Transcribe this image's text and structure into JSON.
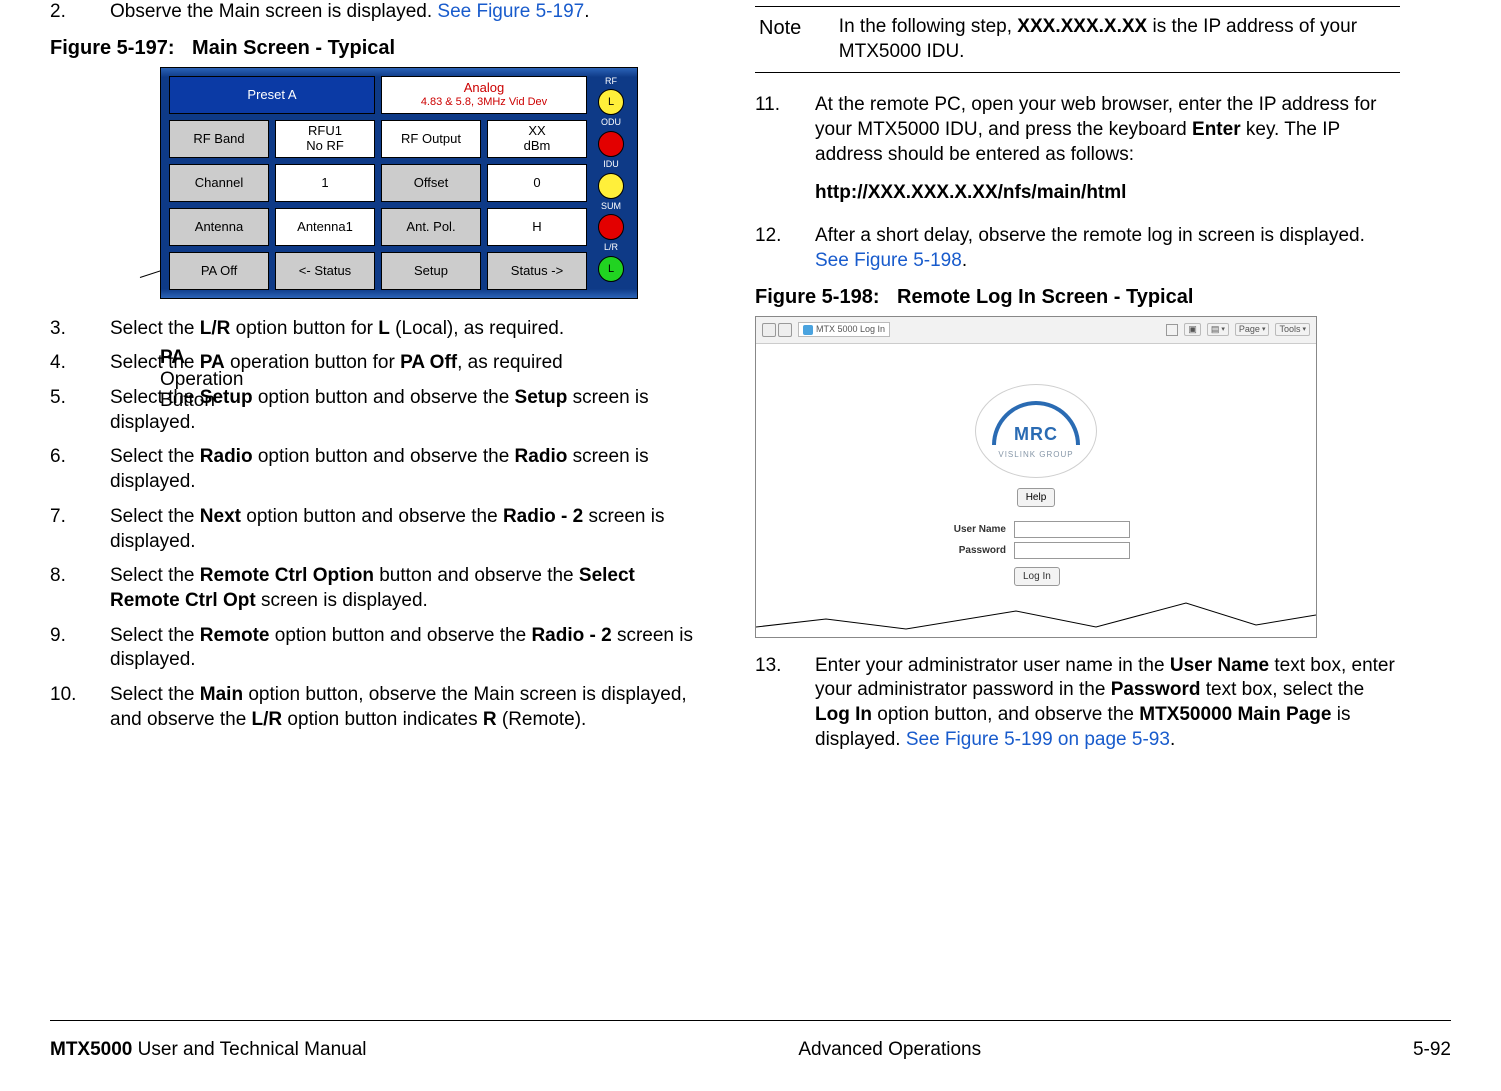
{
  "left": {
    "step2_num": "2.",
    "step2_a": "Observe the Main screen is displayed.  ",
    "step2_link": "See Figure 5-197",
    "step2_dot": ".",
    "fig197_label": "Figure 5-197:",
    "fig197_title": "Main Screen - Typical",
    "callout_l1": "PA",
    "callout_l2": "Operation",
    "callout_l3": "Button",
    "device": {
      "preset": "Preset A",
      "analog1": "Analog",
      "analog2": "4.83 & 5.8, 3MHz Vid Dev",
      "rfband": "RF Band",
      "rfu": "RFU1\nNo RF",
      "rfout": "RF Output",
      "dbm": "XX\ndBm",
      "channel": "Channel",
      "ch_val": "1",
      "offset": "Offset",
      "off_val": "0",
      "antenna": "Antenna",
      "ant_val": "Antenna1",
      "antpol": "Ant. Pol.",
      "pol_val": "H",
      "paoff": "PA Off",
      "back": "<- Status",
      "setup": "Setup",
      "fwd": "Status ->",
      "s_rf": "RF",
      "s_odu": "ODU",
      "s_idu": "IDU",
      "s_sum": "SUM",
      "s_lr": "L/R",
      "led_l": "L"
    },
    "s3n": "3.",
    "s3a": "Select the ",
    "s3b": "L/R",
    "s3c": " option button for ",
    "s3d": "L",
    "s3e": " (Local), as required.",
    "s4n": "4.",
    "s4a": "Select the ",
    "s4b": "PA",
    "s4c": " operation button for ",
    "s4d": "PA Off",
    "s4e": ", as required",
    "s5n": "5.",
    "s5a": "Select the ",
    "s5b": "Setup",
    "s5c": " option button and observe the ",
    "s5d": "Setup",
    "s5e": " screen is displayed.",
    "s6n": "6.",
    "s6a": "Select the ",
    "s6b": "Radio",
    "s6c": " option button and observe the ",
    "s6d": "Radio",
    "s6e": " screen is displayed.",
    "s7n": "7.",
    "s7a": "Select the ",
    "s7b": "Next",
    "s7c": " option button and observe the ",
    "s7d": "Radio - 2",
    "s7e": " screen is displayed.",
    "s8n": "8.",
    "s8a": "Select the ",
    "s8b": "Remote Ctrl Option",
    "s8c": " button and observe the ",
    "s8d": "Select Remote Ctrl Opt",
    "s8e": " screen is displayed.",
    "s9n": "9.",
    "s9a": "Select the ",
    "s9b": "Remote",
    "s9c": " option button and observe the ",
    "s9d": "Radio - 2",
    "s9e": " screen is displayed.",
    "s10n": "10.",
    "s10a": "Select the ",
    "s10b": "Main",
    "s10c": " option button, observe the Main screen is displayed, and observe the ",
    "s10d": "L/R",
    "s10e": " option button indicates ",
    "s10f": "R",
    "s10g": " (Remote)."
  },
  "right": {
    "note_label": "Note",
    "note_a": "In the following step, ",
    "note_b": "XXX.XXX.X.XX",
    "note_c": " is the IP address of your MTX5000 IDU.",
    "s11n": "11.",
    "s11a": "At the remote PC, open your web browser, enter the IP address for your MTX5000 IDU, and press the keyboard ",
    "s11b": "Enter",
    "s11c": " key.  The IP address should be entered as follows:",
    "url": "http://XXX.XXX.X.XX/nfs/main/html",
    "s12n": "12.",
    "s12a": "After a short delay, observe the remote log in screen is displayed.  ",
    "s12link": "See Figure 5-198",
    "s12dot": ".",
    "fig198_label": "Figure 5-198:",
    "fig198_title": "Remote Log In Screen - Typical",
    "login": {
      "tab": "MTX 5000 Log In",
      "page": "Page",
      "tools": "Tools",
      "logo_text": "MRC",
      "logo_sub": "VISLINK GROUP",
      "help": "Help",
      "user_lbl": "User Name",
      "pass_lbl": "Password",
      "login_btn": "Log In"
    },
    "s13n": "13.",
    "s13a": "Enter your administrator user name in the ",
    "s13b": "User Name",
    "s13c": " text box, enter your administrator password in the ",
    "s13d": "Password",
    "s13e": " text box, select the ",
    "s13f": "Log In",
    "s13g": " option button, and observe the ",
    "s13h": "MTX50000 Main Page",
    "s13i": " is displayed.  ",
    "s13link": "See Figure 5-199 on page 5-93",
    "s13dot": "."
  },
  "footer": {
    "left_b": "MTX5000",
    "left_r": " User and Technical Manual",
    "center": "Advanced Operations",
    "right": "5-92"
  }
}
